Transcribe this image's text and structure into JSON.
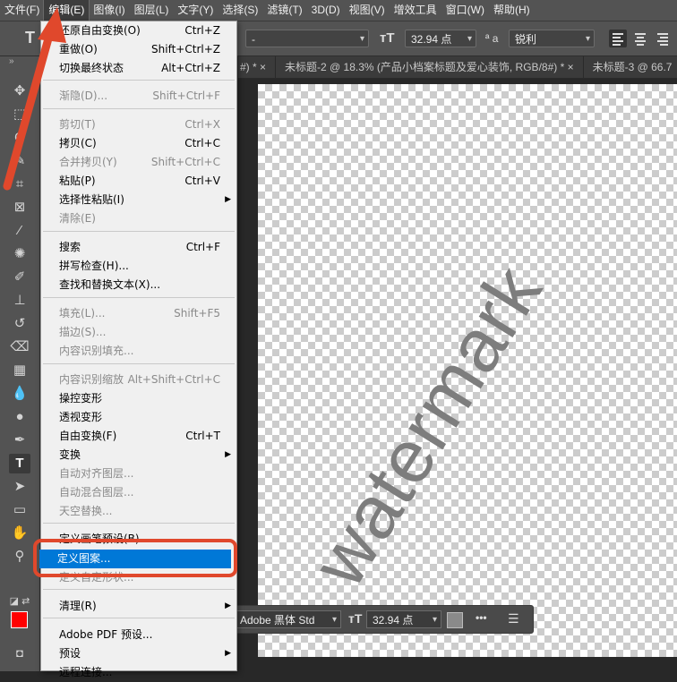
{
  "menubar": {
    "items": [
      "文件(F)",
      "编辑(E)",
      "图像(I)",
      "图层(L)",
      "文字(Y)",
      "选择(S)",
      "滤镜(T)",
      "3D(D)",
      "视图(V)",
      "增效工具",
      "窗口(W)",
      "帮助(H)"
    ],
    "active_index": 1
  },
  "options": {
    "font_style": "-",
    "font_size": "32.94 点",
    "aa_icon": "ª a",
    "antialias": "锐利"
  },
  "tabs": [
    "#) * ×",
    "未标题-2 @ 18.3% (产品小档案标题及爱心装饰, RGB/8#) * ×",
    "未标题-3 @ 66.7"
  ],
  "edit_menu": {
    "items": [
      {
        "label": "还原自由变换(O)",
        "shortcut": "Ctrl+Z",
        "disabled": false
      },
      {
        "label": "重做(O)",
        "shortcut": "Shift+Ctrl+Z",
        "disabled": false
      },
      {
        "label": "切换最终状态",
        "shortcut": "Alt+Ctrl+Z",
        "disabled": false
      },
      {
        "label": "渐隐(D)...",
        "shortcut": "Shift+Ctrl+F",
        "disabled": true
      },
      {
        "label": "剪切(T)",
        "shortcut": "Ctrl+X",
        "disabled": true
      },
      {
        "label": "拷贝(C)",
        "shortcut": "Ctrl+C",
        "disabled": false
      },
      {
        "label": "合并拷贝(Y)",
        "shortcut": "Shift+Ctrl+C",
        "disabled": true
      },
      {
        "label": "粘贴(P)",
        "shortcut": "Ctrl+V",
        "disabled": false
      },
      {
        "label": "选择性粘贴(I)",
        "shortcut": "",
        "disabled": false,
        "submenu": true
      },
      {
        "label": "清除(E)",
        "shortcut": "",
        "disabled": true
      },
      {
        "label": "搜索",
        "shortcut": "Ctrl+F",
        "disabled": false
      },
      {
        "label": "拼写检查(H)...",
        "shortcut": "",
        "disabled": false
      },
      {
        "label": "查找和替换文本(X)...",
        "shortcut": "",
        "disabled": false
      },
      {
        "label": "填充(L)...",
        "shortcut": "Shift+F5",
        "disabled": true
      },
      {
        "label": "描边(S)...",
        "shortcut": "",
        "disabled": true
      },
      {
        "label": "内容识别填充...",
        "shortcut": "",
        "disabled": true
      },
      {
        "label": "内容识别缩放",
        "shortcut": "Alt+Shift+Ctrl+C",
        "disabled": true
      },
      {
        "label": "操控变形",
        "shortcut": "",
        "disabled": false
      },
      {
        "label": "透视变形",
        "shortcut": "",
        "disabled": false
      },
      {
        "label": "自由变换(F)",
        "shortcut": "Ctrl+T",
        "disabled": false
      },
      {
        "label": "变换",
        "shortcut": "",
        "disabled": false,
        "submenu": true
      },
      {
        "label": "自动对齐图层...",
        "shortcut": "",
        "disabled": true
      },
      {
        "label": "自动混合图层...",
        "shortcut": "",
        "disabled": true
      },
      {
        "label": "天空替换...",
        "shortcut": "",
        "disabled": true
      },
      {
        "label": "定义画笔预设(B)...",
        "shortcut": "",
        "disabled": false
      },
      {
        "label": "定义图案...",
        "shortcut": "",
        "disabled": false,
        "highlighted": true
      },
      {
        "label": "定义自定形状...",
        "shortcut": "",
        "disabled": true
      },
      {
        "label": "清理(R)",
        "shortcut": "",
        "disabled": false,
        "submenu": true
      },
      {
        "label": "Adobe PDF 预设...",
        "shortcut": "",
        "disabled": false
      },
      {
        "label": "预设",
        "shortcut": "",
        "disabled": false,
        "submenu": true
      },
      {
        "label": "远程连接...",
        "shortcut": "",
        "disabled": false
      }
    ]
  },
  "canvas": {
    "watermark_text": "watermark"
  },
  "floatbar": {
    "font_name": "Adobe 黑体 Std",
    "font_size": "32.94 点",
    "more": "•••"
  },
  "colors": {
    "foreground": "#ff0000",
    "background": "#ffffff",
    "highlight": "#0078d7",
    "annotation": "#e0482c"
  }
}
